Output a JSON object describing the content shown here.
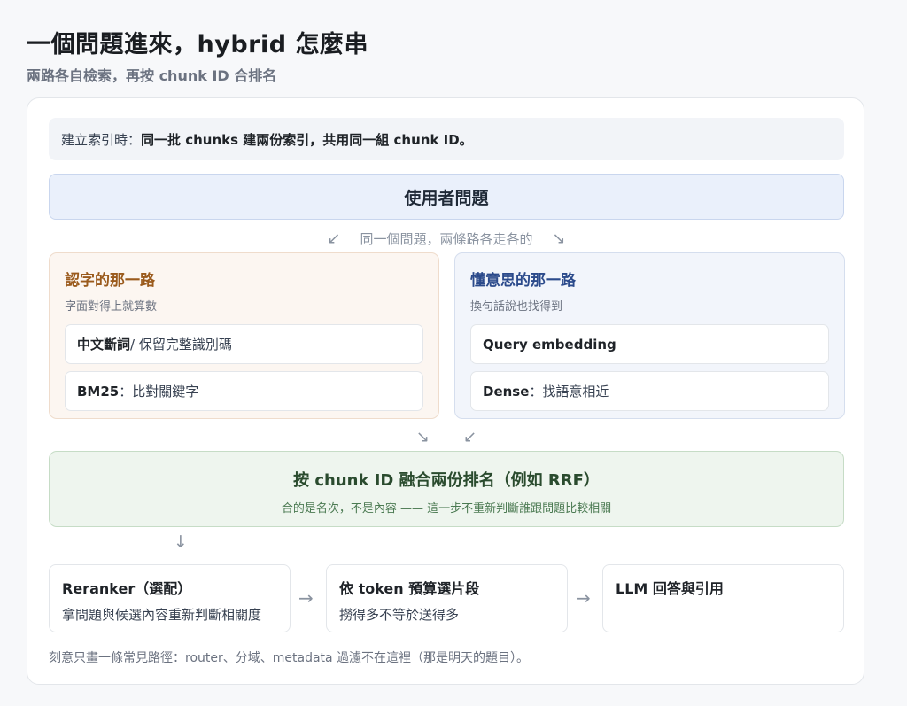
{
  "header": {
    "title": "一個問題進來，hybrid 怎麼串",
    "subtitle": "兩路各自檢索，再按 chunk ID 合排名"
  },
  "note": {
    "prefix": "建立索引時：",
    "bold": "同一批 chunks 建兩份索引，共用同一組 chunk ID。"
  },
  "question": "使用者問題",
  "split": {
    "left_arrow": "↙",
    "label": "同一個問題，兩條路各走各的",
    "right_arrow": "↘"
  },
  "lanes": [
    {
      "title": "認字的那一路",
      "subtitle": "字面對得上就算數",
      "items": [
        {
          "bold": "中文斷詞",
          "rest": " / 保留完整識別碼"
        },
        {
          "bold": "BM25",
          "rest": "：比對關鍵字"
        }
      ]
    },
    {
      "title": "懂意思的那一路",
      "subtitle": "換句話說也找得到",
      "items": [
        {
          "bold": "Query embedding",
          "rest": ""
        },
        {
          "bold": "Dense",
          "rest": "：找語意相近"
        }
      ]
    }
  ],
  "merge": {
    "left_arrow": "↘",
    "right_arrow": "↙"
  },
  "fuse": {
    "title": "按 chunk ID 融合兩份排名（例如 RRF）",
    "subtitle": "合的是名次，不是內容 —— 這一步不重新判斷誰跟問題比較相關"
  },
  "down_arrow": "↓",
  "steps": [
    {
      "title": "Reranker（選配）",
      "desc": "拿問題與候選內容重新判斷相關度"
    },
    {
      "title": "依 token 預算選片段",
      "desc": "撈得多不等於送得多"
    },
    {
      "title": "LLM 回答與引用",
      "desc": ""
    }
  ],
  "step_arrow": "→",
  "footnote": "刻意只畫一條常見路徑：router、分域、metadata 過濾不在這裡（那是明天的題目）。"
}
